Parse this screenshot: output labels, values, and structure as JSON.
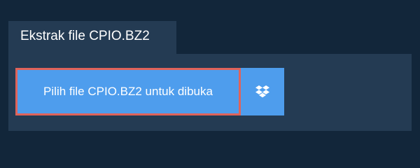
{
  "tab": {
    "label": "Ekstrak file CPIO.BZ2"
  },
  "actions": {
    "open_file_label": "Pilih file CPIO.BZ2 untuk dibuka",
    "cloud_icon": "dropbox-icon"
  },
  "colors": {
    "background": "#12263a",
    "panel": "#243b53",
    "button": "#4e9ded",
    "focus_outline": "#e0635a",
    "text": "#ffffff"
  }
}
